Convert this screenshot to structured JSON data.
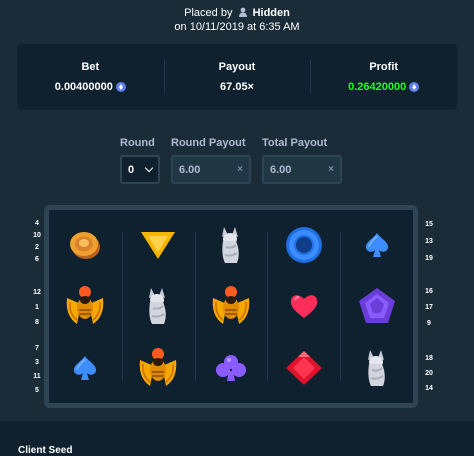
{
  "header": {
    "placed_by": "Placed by",
    "user": "Hidden",
    "date_line": "on 10/11/2019 at 6:35 AM"
  },
  "stats": [
    {
      "label": "Bet",
      "value": "0.00400000",
      "icon": "ethereum-icon"
    },
    {
      "label": "Payout",
      "value": "67.05×"
    },
    {
      "label": "Profit",
      "value": "0.26420000",
      "icon": "ethereum-icon",
      "color": "#1fff20"
    }
  ],
  "round": {
    "label": "Round",
    "value": "0"
  },
  "round_payout": {
    "label": "Round Payout",
    "value": "6.00"
  },
  "total_payout": {
    "label": "Total Payout",
    "value": "6.00"
  },
  "left_numbers": [
    [
      "4",
      "10",
      "2",
      "6"
    ],
    [
      "12",
      "1",
      "8"
    ],
    [
      "7",
      "3",
      "11",
      "5"
    ]
  ],
  "right_numbers": [
    [
      "15",
      "13",
      "19"
    ],
    [
      "16",
      "17",
      "9"
    ],
    [
      "18",
      "20",
      "14"
    ]
  ],
  "reels": [
    [
      "coin-icon",
      "scarab-icon",
      "spade-icon"
    ],
    [
      "triangle-icon",
      "wolf-icon",
      "scarab-icon"
    ],
    [
      "wolf-icon",
      "scarab-icon",
      "club-icon"
    ],
    [
      "ring-icon",
      "heart-icon",
      "diamond-icon"
    ],
    [
      "spade-icon",
      "pentagon-icon",
      "wolf-icon"
    ]
  ],
  "colors": {
    "background": "#1a2c38",
    "panel": "#0f212e",
    "border": "#2f4553",
    "profit_green": "#1fff20"
  },
  "client_seed": {
    "label": "Client Seed"
  }
}
